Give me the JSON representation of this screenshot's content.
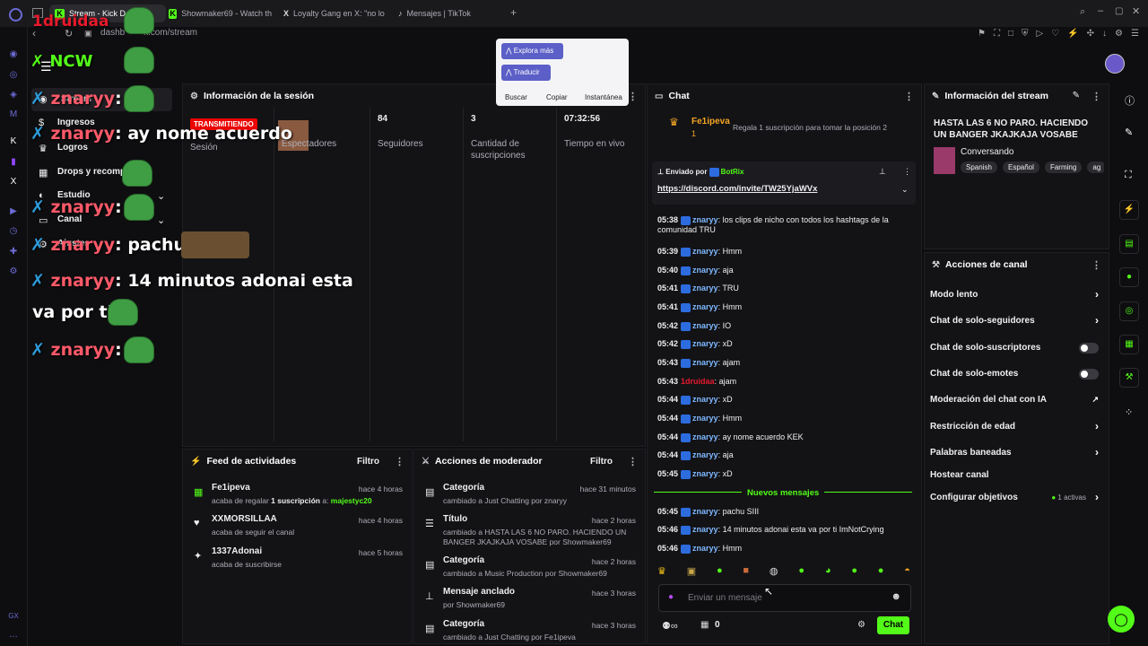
{
  "browser": {
    "tabs": [
      {
        "label": "Stream - Kick Dash",
        "active": true
      },
      {
        "label": "Showmaker69 - Watch th"
      },
      {
        "label": "Loyalty Gang en X: \"no lo"
      },
      {
        "label": "Mensajes | TikTok"
      }
    ],
    "url": "dashb...k.com/stream",
    "url_prefix": "dashb",
    "url_suffix": "k.com/stream"
  },
  "context_menu": {
    "explore": "Explora más",
    "translate": "Traducir",
    "search": "Buscar",
    "copy": "Copiar",
    "snapshot": "Instantánea"
  },
  "left_nav": {
    "items": [
      "Stream",
      "Ingresos",
      "Logros",
      "Drops y recompensas",
      "Estudio",
      "Canal",
      "Ajustes"
    ]
  },
  "session": {
    "title": "Información de la sesión",
    "live_badge": "TRANSMITIENDO",
    "session_label": "Sesión",
    "viewers_label": "Espectadores",
    "followers_value": "84",
    "followers_label": "Seguidores",
    "subs_value": "3",
    "subs_label": "Cantidad de suscripciones",
    "time_value": "07:32:56",
    "time_label": "Tiempo en vivo"
  },
  "feed": {
    "title": "Feed de actividades",
    "filter": "Filtro",
    "items": [
      {
        "name": "Fe1ipeva",
        "sub_pre": "acaba de regalar ",
        "sub_bold": "1 suscripción",
        "sub_mid": " a: ",
        "sub_user": "majestyc20",
        "time": "hace 4 horas"
      },
      {
        "name": "XXMORSILLAA",
        "sub_pre": "acaba de seguir el canal",
        "time": "hace 4 horas"
      },
      {
        "name": "1337Adonai",
        "sub_pre": "acaba de suscribirse",
        "time": "hace 5 horas"
      }
    ]
  },
  "mod": {
    "title": "Acciones de moderador",
    "filter": "Filtro",
    "items": [
      {
        "title": "Categoría",
        "time": "hace 31 minutos",
        "l1": "cambiado a Just Chatting por znaryy"
      },
      {
        "title": "Título",
        "time": "hace 2 horas",
        "l1": "cambiado a HASTA LAS 6 NO PARO. HACIENDO UN",
        "l2": "BANGER JKAJKAJA VOSABE por Showmaker69"
      },
      {
        "title": "Categoría",
        "time": "hace 2 horas",
        "l1": "cambiado a Music Production por Showmaker69"
      },
      {
        "title": "Mensaje anclado",
        "time": "hace 3 horas",
        "l1": "por Showmaker69"
      },
      {
        "title": "Categoría",
        "time": "hace 3 horas",
        "l1": "cambiado a Just Chatting por Fe1ipeva"
      }
    ]
  },
  "chat": {
    "title": "Chat",
    "top_user": "Fe1ipeva",
    "top_count": "1",
    "gift_text": "Regala 1 suscripción para tomar la posición 2",
    "pinned_label": "Enviado por",
    "pinned_user": "BotRix",
    "pinned_link": "https://discord.com/invite/TW25YjaWVx",
    "messages": [
      {
        "time": "05:38",
        "user": "znaryy",
        "text": "los clips de nicho con todos los hashtags de la",
        "text2": "comunidad TRU"
      },
      {
        "time": "05:39",
        "user": "znaryy",
        "text": "Hmm"
      },
      {
        "time": "05:40",
        "user": "znaryy",
        "text": "aja"
      },
      {
        "time": "05:41",
        "user": "znaryy",
        "text": "TRU"
      },
      {
        "time": "05:41",
        "user": "znaryy",
        "text": "Hmm"
      },
      {
        "time": "05:42",
        "user": "znaryy",
        "text": "IO"
      },
      {
        "time": "05:42",
        "user": "znaryy",
        "text": "xD"
      },
      {
        "time": "05:43",
        "user": "znaryy",
        "text": "ajam"
      },
      {
        "time": "05:43",
        "user": "1druidaa",
        "text": "ajam",
        "red": true
      },
      {
        "time": "05:44",
        "user": "znaryy",
        "text": "xD"
      },
      {
        "time": "05:44",
        "user": "znaryy",
        "text": "Hmm"
      },
      {
        "time": "05:44",
        "user": "znaryy",
        "text": "ay nome acuerdo KEK"
      },
      {
        "time": "05:44",
        "user": "znaryy",
        "text": "aja"
      },
      {
        "time": "05:45",
        "user": "znaryy",
        "text": "xD"
      }
    ],
    "new_messages": "Nuevos mensajes",
    "new": [
      {
        "time": "05:45",
        "user": "znaryy",
        "text": "pachu SIII"
      },
      {
        "time": "05:46",
        "user": "znaryy",
        "text": "14 minutos adonai esta va por ti ImNotCrying"
      },
      {
        "time": "05:46",
        "user": "znaryy",
        "text": "Hmm"
      }
    ],
    "placeholder": "Enviar un mensaje",
    "points": "0",
    "send": "Chat"
  },
  "stream_info": {
    "title": "Información del stream",
    "stream_title": "HASTA LAS 6 NO PARO. HACIENDO UN BANGER JKAJKAJA VOSABE",
    "category": "Conversando",
    "tags": [
      "Spanish",
      "Español",
      "Farming",
      "ag"
    ]
  },
  "channel_actions": {
    "title": "Acciones de canal",
    "items": [
      {
        "label": "Modo lento",
        "kind": "chev"
      },
      {
        "label": "Chat de solo-seguidores",
        "kind": "chev"
      },
      {
        "label": "Chat de solo-suscriptores",
        "kind": "toggle"
      },
      {
        "label": "Chat de solo-emotes",
        "kind": "toggle"
      },
      {
        "label": "Moderación del chat con IA",
        "kind": "ext"
      },
      {
        "label": "Restricción de edad",
        "kind": "chev"
      },
      {
        "label": "Palabras baneadas",
        "kind": "chev"
      },
      {
        "label": "Hostear canal",
        "kind": "none"
      },
      {
        "label": "Configurar objetivos",
        "kind": "chev",
        "extra": "1 activas"
      }
    ]
  },
  "overlay": {
    "name1": "1druidaa",
    "user": "znaryy",
    "lines": [
      "ay nome acuerdo",
      "pachu",
      "14 minutos adonai esta",
      "va por ti"
    ]
  },
  "sidebar_bottom": "GX"
}
